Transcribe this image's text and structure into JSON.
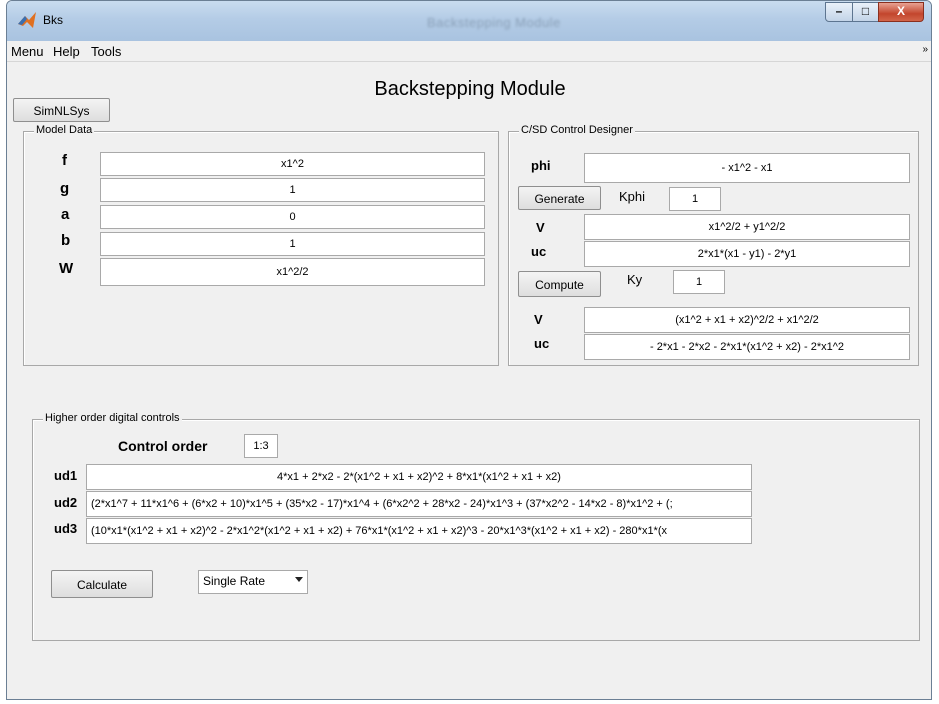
{
  "window": {
    "title": "Bks",
    "title_center": "Backstepping Module",
    "controls": {
      "minimize": "–",
      "maximize": "□",
      "close": "X"
    }
  },
  "menu": {
    "items": [
      "Menu",
      "Help",
      "Tools"
    ],
    "arrow": "»"
  },
  "header": {
    "title": "Backstepping Module"
  },
  "simnlsys_label": "SimNLSys",
  "model_data": {
    "title": "Model Data",
    "rows": [
      {
        "label": "f",
        "value": "x1^2"
      },
      {
        "label": "g",
        "value": "1"
      },
      {
        "label": "a",
        "value": "0"
      },
      {
        "label": "b",
        "value": "1"
      },
      {
        "label": "W",
        "value": "x1^2/2"
      }
    ]
  },
  "designer": {
    "title": "C/SD Control Designer",
    "phi_label": "phi",
    "phi_value": "- x1^2 - x1",
    "generate_label": "Generate",
    "kphi_label": "Kphi",
    "kphi_value": "1",
    "v1_label": "V",
    "v1_value": "x1^2/2 + y1^2/2",
    "uc1_label": "uc",
    "uc1_value": "2*x1*(x1 - y1) - 2*y1",
    "compute_label": "Compute",
    "ky_label": "Ky",
    "ky_value": "1",
    "v2_label": "V",
    "v2_value": "(x1^2 + x1 + x2)^2/2 + x1^2/2",
    "uc2_label": "uc",
    "uc2_value": "- 2*x1 - 2*x2 - 2*x1*(x1^2 + x2) - 2*x1^2"
  },
  "digital": {
    "title": "Higher order digital controls",
    "order_label": "Control order",
    "order_value": "1:3",
    "ud1_label": "ud1",
    "ud1_value": "4*x1 + 2*x2 - 2*(x1^2 + x1 + x2)^2 + 8*x1*(x1^2 + x1 + x2)",
    "ud2_label": "ud2",
    "ud2_value": "(2*x1^7 + 11*x1^6 + (6*x2 + 10)*x1^5 + (35*x2 - 17)*x1^4 + (6*x2^2 + 28*x2 - 24)*x1^3 + (37*x2^2 - 14*x2 - 8)*x1^2 + (;",
    "ud3_label": "ud3",
    "ud3_value": "(10*x1*(x1^2 + x1 + x2)^2 - 2*x1^2*(x1^2 + x1 + x2) + 76*x1*(x1^2 + x1 + x2)^3 - 20*x1^3*(x1^2 + x1 + x2) - 280*x1*(x",
    "calculate_label": "Calculate",
    "rate_value": "Single Rate"
  }
}
